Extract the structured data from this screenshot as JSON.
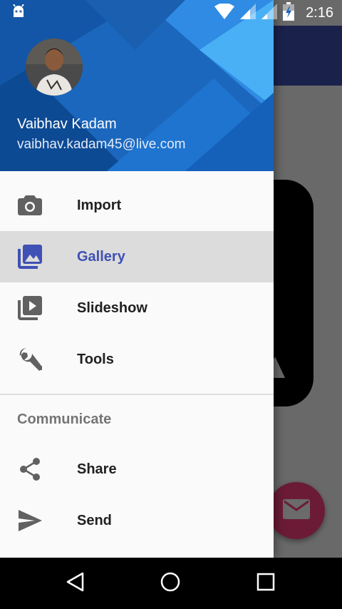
{
  "status_bar": {
    "time": "2:16",
    "icons": [
      "android-notification-icon",
      "wifi-icon",
      "signal-icon",
      "signal-icon",
      "battery-icon"
    ]
  },
  "drawer": {
    "header": {
      "user_name": "Vaibhav Kadam",
      "user_email": "vaibhav.kadam45@live.com"
    },
    "items": [
      {
        "label": "Import",
        "icon": "camera-icon",
        "selected": false
      },
      {
        "label": "Gallery",
        "icon": "gallery-icon",
        "selected": true
      },
      {
        "label": "Slideshow",
        "icon": "slideshow-icon",
        "selected": false
      },
      {
        "label": "Tools",
        "icon": "wrench-icon",
        "selected": false
      }
    ],
    "section": {
      "title": "Communicate",
      "items": [
        {
          "label": "Share",
          "icon": "share-icon"
        },
        {
          "label": "Send",
          "icon": "send-icon"
        }
      ]
    }
  },
  "fab": {
    "icon": "email-icon"
  },
  "colors": {
    "primary": "#3f51b5",
    "accent": "#ff4081",
    "header_blue": "#1a64b8",
    "selected_bg": "#dcdcdc"
  },
  "nav_bar": {
    "buttons": [
      "back-icon",
      "home-icon",
      "recents-icon"
    ]
  }
}
